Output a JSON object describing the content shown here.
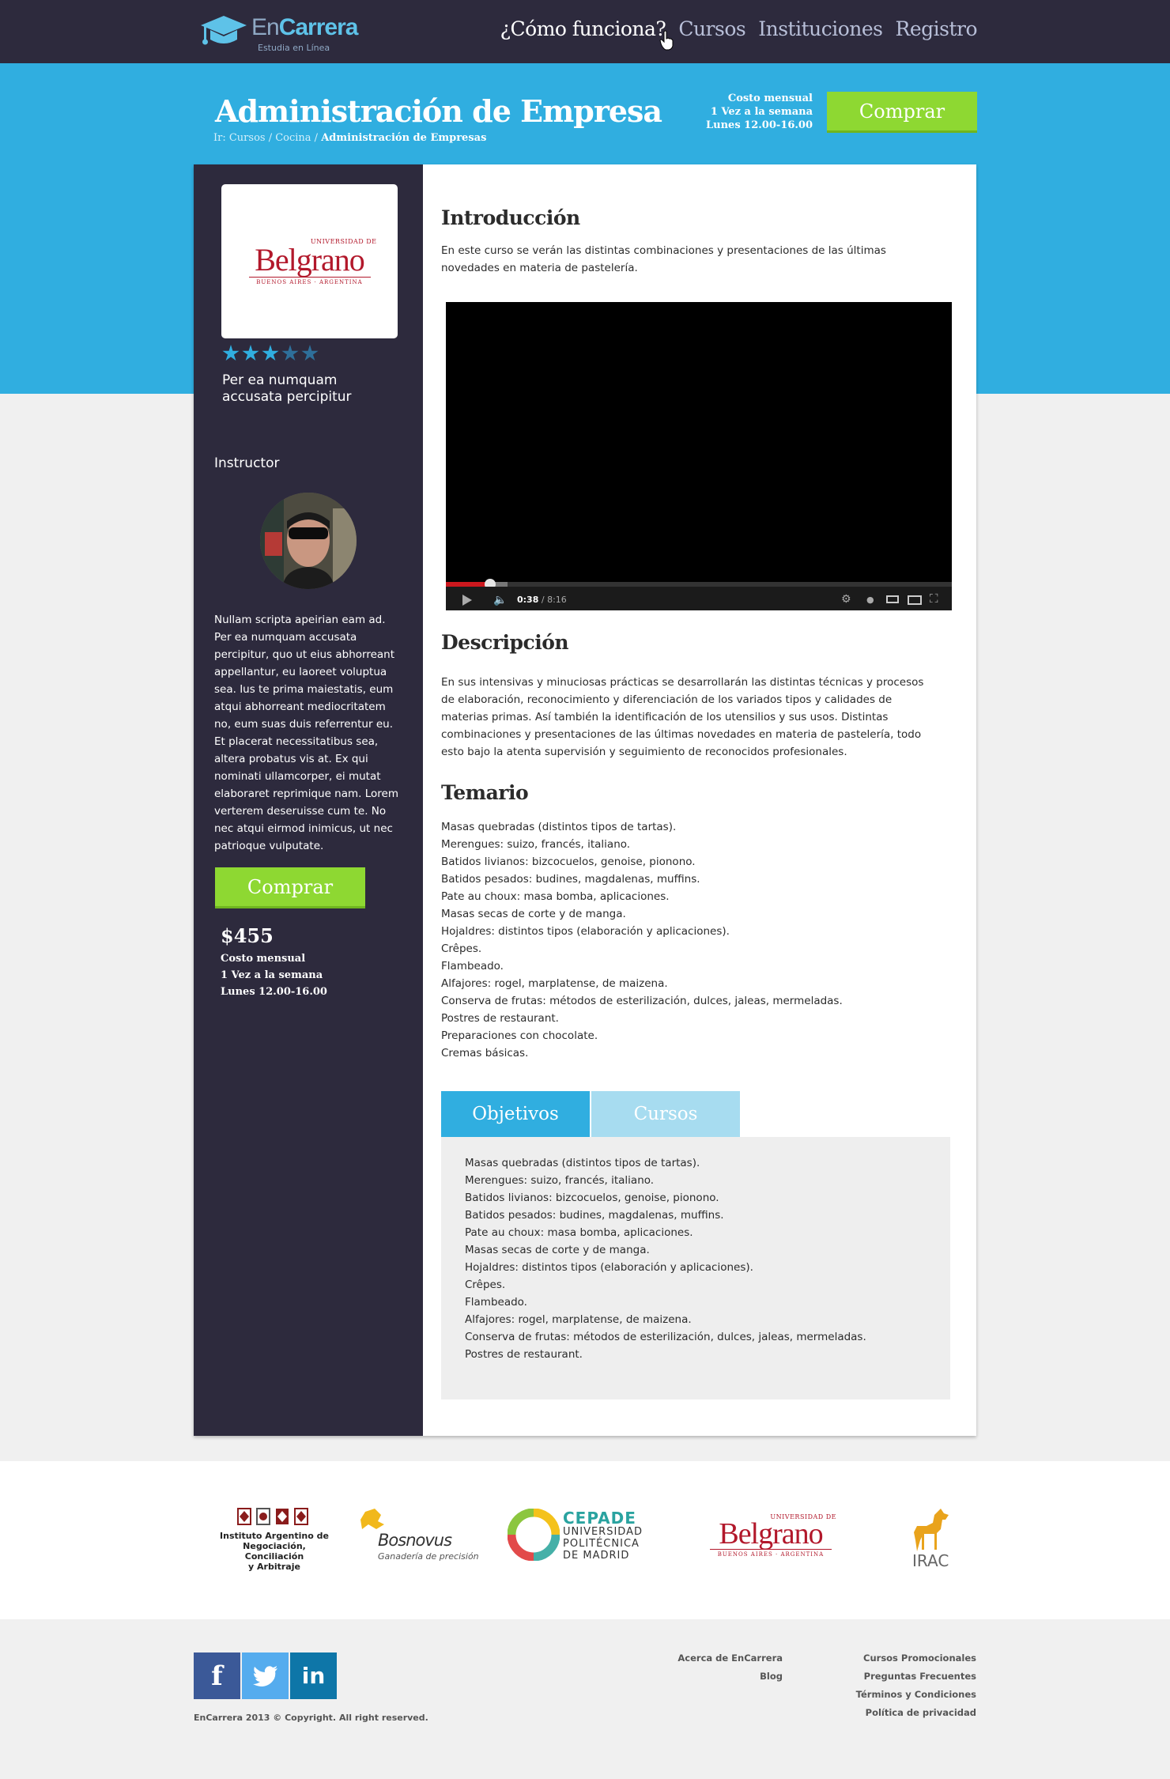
{
  "header": {
    "logo_en": "En",
    "logo_carrera": "Carrera",
    "logo_tagline": "Estudia en Línea",
    "nav": [
      "¿Cómo funciona?",
      "Cursos",
      "Instituciones",
      "Registro"
    ]
  },
  "course": {
    "title": "Administración de Empresa",
    "breadcrumb_prefix": "Ir: Cursos / Cocina / ",
    "breadcrumb_current": "Administración de Empresas",
    "schedule": [
      "Costo mensual",
      "1 Vez a la semana",
      "Lunes 12.00-16.00"
    ],
    "buy_label": "Comprar",
    "price": "$455"
  },
  "sidebar": {
    "institution_logo_text": "Belgrano",
    "institution_logo_top": "UNIVERSIDAD DE",
    "institution_logo_bottom": "BUENOS AIRES · ARGENTINA",
    "rating": 3,
    "rating_max": 5,
    "tagline": "Per ea numquam accusata percipitur",
    "instructor_heading": "Instructor",
    "bio": "Nullam scripta apeirian eam ad. Per ea numquam accusata percipitur, quo ut eius abhorreant appellantur, eu laoreet voluptua sea. Ius te prima maiestatis, eum atqui abhorreant mediocritatem no, eum suas duis referrentur eu. Et placerat necessitatibus sea, altera probatus vis at. Ex qui nominati ullamcorper, ei mutat elaboraret reprimique nam. Lorem verterem deseruisse cum te. No nec atqui eirmod inimicus, ut nec patrioque vulputate."
  },
  "main": {
    "intro_heading": "Introducción",
    "intro_text": "En este curso se verán las distintas combinaciones y presentaciones de las últimas novedades en materia de pastelería.",
    "video": {
      "time_current": "0:38",
      "time_total": " / 8:16",
      "progress": 0.088
    },
    "description_heading": "Descripción",
    "description_text": "En sus intensivas y minuciosas prácticas se desarrollarán las distintas técnicas y procesos de elaboración, reconocimiento y diferenciación de los variados tipos y calidades de materias primas. Así también la identificación de los utensilios y sus usos. Distintas combinaciones y presentaciones de las últimas novedades en materia de pastelería, todo esto bajo la atenta supervisión y seguimiento de reconocidos profesionales.",
    "syllabus_heading": "Temario",
    "syllabus": [
      "Masas quebradas (distintos tipos de tartas).",
      "Merengues: suizo, francés, italiano.",
      "Batidos livianos: bizcocuelos, genoise, pionono.",
      "Batidos pesados: budines, magdalenas, muffins.",
      "Pate au choux: masa bomba, aplicaciones.",
      "Masas secas de corte y de manga.",
      "Hojaldres: distintos tipos (elaboración y aplicaciones).",
      "Crêpes.",
      "Flambeado.",
      "Alfajores: rogel, marplatense, de maizena.",
      "Conserva de frutas: métodos de esterilización, dulces, jaleas, mermeladas.",
      "Postres de restaurant.",
      "Preparaciones con chocolate.",
      "Cremas básicas."
    ],
    "tabs": [
      "Objetivos",
      "Cursos"
    ],
    "objectives": [
      "Masas quebradas (distintos tipos de tartas).",
      "Merengues: suizo, francés, italiano.",
      "Batidos livianos: bizcocuelos, genoise, pionono.",
      "Batidos pesados: budines, magdalenas, muffins.",
      "Pate au choux: masa bomba, aplicaciones.",
      "Masas secas de corte y de manga.",
      "Hojaldres: distintos tipos (elaboración y aplicaciones).",
      "Crêpes.",
      "Flambeado.",
      "Alfajores: rogel, marplatense, de maizena.",
      "Conserva de frutas: métodos de esterilización, dulces, jaleas, mermeladas.",
      "Postres de restaurant."
    ]
  },
  "partners": {
    "iana": [
      "Instituto Argentino de",
      "Negociación, Conciliación",
      "y Arbitraje"
    ],
    "bosnovus": [
      "Bosnovus",
      "Ganadería de precisión"
    ],
    "cepade": [
      "CEPADE",
      "UNIVERSIDAD",
      "POLITÉCNICA",
      "DE MADRID"
    ],
    "belgrano": [
      "UNIVERSIDAD DE",
      "Belgrano",
      "BUENOS AIRES · ARGENTINA"
    ],
    "irac": "IRAC"
  },
  "footer": {
    "social": [
      "f",
      "t",
      "in"
    ],
    "col1": [
      "Acerca de EnCarrera",
      "Blog"
    ],
    "col2": [
      "Cursos Promocionales",
      "Preguntas Frecuentes",
      "Términos y Condiciones",
      "Política de privacidad"
    ],
    "copyright": "EnCarrera 2013 © Copyright. All right reserved."
  },
  "colors": {
    "topbar": "#2d2a3d",
    "hero": "#30aee0",
    "buy": "#8ed832",
    "tab_on": "#30aee0",
    "tab_off": "#a7dcf0"
  }
}
